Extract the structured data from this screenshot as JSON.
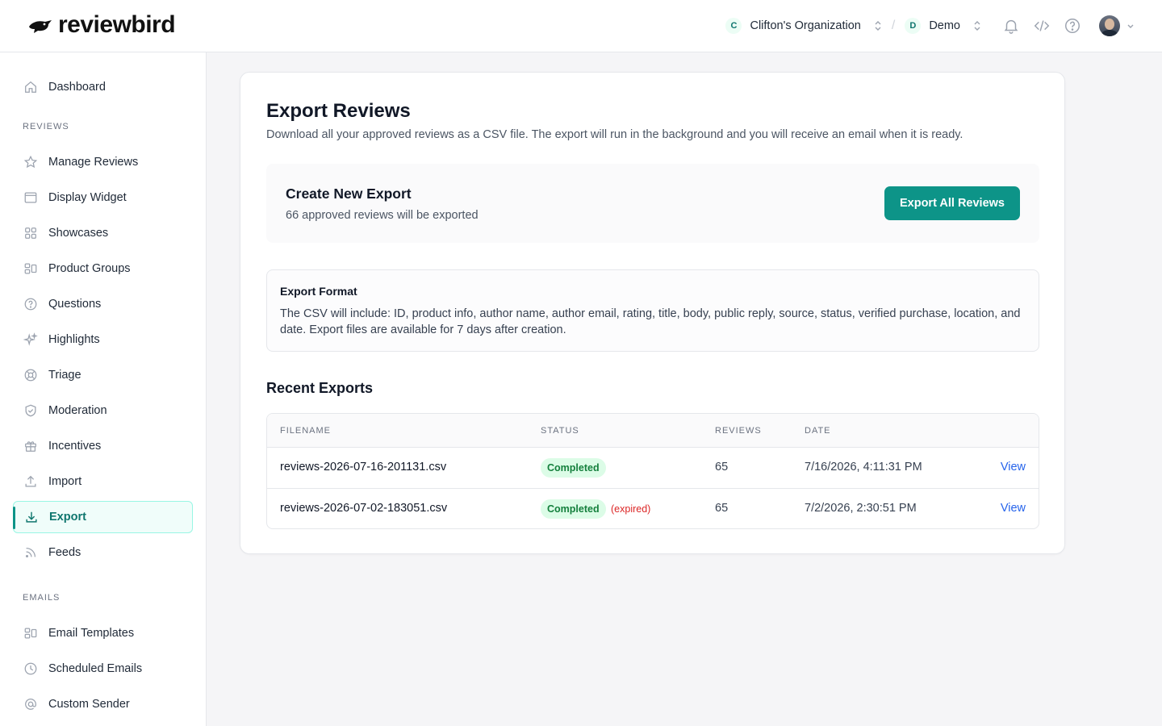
{
  "brand": {
    "name": "reviewbird"
  },
  "header": {
    "org": {
      "letter": "C",
      "name": "Clifton's Organization"
    },
    "separator": "/",
    "store": {
      "letter": "D",
      "name": "Demo"
    }
  },
  "sidebar": {
    "top_items": [
      {
        "label": "Dashboard",
        "icon": "home-icon"
      }
    ],
    "reviews_label": "REVIEWS",
    "reviews_items": [
      {
        "label": "Manage Reviews",
        "icon": "star-icon"
      },
      {
        "label": "Display Widget",
        "icon": "window-icon"
      },
      {
        "label": "Showcases",
        "icon": "grid-icon"
      },
      {
        "label": "Product Groups",
        "icon": "group-icon"
      },
      {
        "label": "Questions",
        "icon": "question-icon"
      },
      {
        "label": "Highlights",
        "icon": "sparkles-icon"
      },
      {
        "label": "Triage",
        "icon": "lifebuoy-icon"
      },
      {
        "label": "Moderation",
        "icon": "shield-icon"
      },
      {
        "label": "Incentives",
        "icon": "gift-icon"
      },
      {
        "label": "Import",
        "icon": "upload-icon"
      },
      {
        "label": "Export",
        "icon": "download-icon",
        "active": true
      },
      {
        "label": "Feeds",
        "icon": "rss-icon"
      }
    ],
    "emails_label": "EMAILS",
    "emails_items": [
      {
        "label": "Email Templates",
        "icon": "template-icon"
      },
      {
        "label": "Scheduled Emails",
        "icon": "clock-icon"
      },
      {
        "label": "Custom Sender",
        "icon": "at-icon"
      }
    ]
  },
  "main": {
    "title": "Export Reviews",
    "description": "Download all your approved reviews as a CSV file. The export will run in the background and you will receive an email when it is ready.",
    "create": {
      "title": "Create New Export",
      "subtitle": "66 approved reviews will be exported",
      "button": "Export All Reviews"
    },
    "format": {
      "title": "Export Format",
      "text": "The CSV will include: ID, product info, author name, author email, rating, title, body, public reply, source, status, verified purchase, location, and date. Export files are available for 7 days after creation."
    },
    "recent": {
      "title": "Recent Exports",
      "columns": [
        "FILENAME",
        "STATUS",
        "REVIEWS",
        "DATE"
      ],
      "rows": [
        {
          "filename": "reviews-2026-07-16-201131.csv",
          "status": "Completed",
          "note": "",
          "reviews": "65",
          "date": "7/16/2026, 4:11:31 PM",
          "action": "View"
        },
        {
          "filename": "reviews-2026-07-02-183051.csv",
          "status": "Completed",
          "note": "(expired)",
          "reviews": "65",
          "date": "7/2/2026, 2:30:51 PM",
          "action": "View"
        }
      ]
    }
  }
}
